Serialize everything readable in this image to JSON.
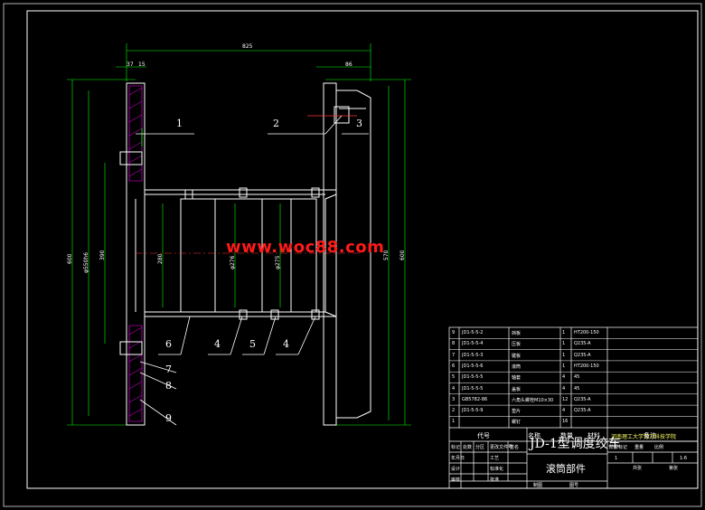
{
  "watermark": "www.woc88.com",
  "dimensions": {
    "overall_width": "825",
    "top_left_a": "37",
    "top_left_b": "15",
    "top_right": "86",
    "left_outer": "600",
    "left_mid": "φ550h6",
    "left_inner": "390",
    "right_inner": "570",
    "right_outer": "600",
    "inner_1": "280",
    "inner_2": "φ276",
    "inner_3": "φ275"
  },
  "part_labels": [
    "1",
    "2",
    "3",
    "4",
    "5",
    "4",
    "6",
    "7",
    "8",
    "9"
  ],
  "bom": {
    "rows": [
      {
        "no": "9",
        "code": "JD1-5-5-2",
        "name": "挡板",
        "qty": "1",
        "material": "HT200-150"
      },
      {
        "no": "8",
        "code": "JD1-5-5-4",
        "name": "压板",
        "qty": "1",
        "material": "Q235-A"
      },
      {
        "no": "7",
        "code": "JD1-5-5-3",
        "name": "键板",
        "qty": "1",
        "material": "Q235-A"
      },
      {
        "no": "6",
        "code": "JD1-5-5-6",
        "name": "滚筒",
        "qty": "1",
        "material": "HT200-150"
      },
      {
        "no": "5",
        "code": "JD1-5-5-5",
        "name": "轴套",
        "qty": "4",
        "material": "45"
      },
      {
        "no": "4",
        "code": "JD1-5-5-5",
        "name": "盖板",
        "qty": "4",
        "material": "45"
      },
      {
        "no": "3",
        "code": "GB5782-86",
        "name": "六角头螺栓M10×30",
        "qty": "12",
        "material": "Q235-A"
      },
      {
        "no": "2",
        "code": "JD1-5-5-9",
        "name": "垫片",
        "qty": "4",
        "material": "Q235-A"
      },
      {
        "no": "1",
        "code": "",
        "name": "螺钉",
        "qty": "16",
        "material": ""
      }
    ],
    "header": {
      "code": "代号",
      "name": "名称",
      "qty": "数量",
      "material": "材料",
      "remark": "备注"
    }
  },
  "title_block": {
    "drawing_title": "JD-1型调度绞车",
    "part_title": "滚筒部件",
    "school": "河南理工大学万方科技学院",
    "scale": "1:6",
    "sheet": "1",
    "labels": [
      "标记",
      "处数",
      "分区",
      "更改文件号",
      "签名",
      "年月日",
      "设计",
      "标准化",
      "阶段标记",
      "重量",
      "比例",
      "审核",
      "工艺",
      "批准",
      "共张",
      "第张"
    ],
    "bottom_left": "制图",
    "bottom_right": "图号"
  },
  "colors": {
    "background": "#000000",
    "line": "#ffffff",
    "dim": "#00ff00",
    "hatch": "#ff00ff",
    "center": "#ff3333",
    "highlight": "#ffff00"
  }
}
